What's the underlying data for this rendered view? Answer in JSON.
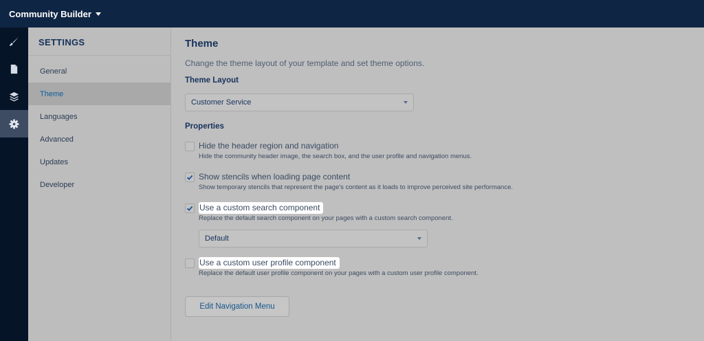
{
  "topbar": {
    "app_title": "Community Builder"
  },
  "iconrail": {
    "items": [
      "paintbrush-icon",
      "page-icon",
      "layers-icon",
      "gear-icon"
    ]
  },
  "settings": {
    "title": "SETTINGS",
    "items": [
      {
        "label": "General",
        "active": false
      },
      {
        "label": "Theme",
        "active": true
      },
      {
        "label": "Languages",
        "active": false
      },
      {
        "label": "Advanced",
        "active": false
      },
      {
        "label": "Updates",
        "active": false
      },
      {
        "label": "Developer",
        "active": false
      }
    ]
  },
  "main": {
    "title": "Theme",
    "subtitle": "Change the theme layout of your template and set theme options.",
    "theme_layout_label": "Theme Layout",
    "theme_layout_value": "Customer Service",
    "properties_label": "Properties",
    "properties": [
      {
        "label": "Hide the header region and navigation",
        "description": "Hide the community header image, the search box, and the user profile and navigation menus.",
        "checked": false
      },
      {
        "label": "Show stencils when loading page content",
        "description": "Show temporary stencils that represent the page's content as it loads to improve perceived site performance.",
        "checked": true
      },
      {
        "label": "Use a custom search component",
        "description": "Replace the default search component on your pages with a custom search component.",
        "checked": true
      },
      {
        "label": "Use a custom user profile component",
        "description": "Replace the default user profile component on your pages with a custom user profile component.",
        "checked": false
      }
    ],
    "search_component_value": "Default",
    "edit_nav_button": "Edit Navigation Menu"
  },
  "colors": {
    "topbar": "#0f2544",
    "iconrail": "#061428",
    "accent": "#0b5c9e",
    "check": "#1b5297"
  }
}
